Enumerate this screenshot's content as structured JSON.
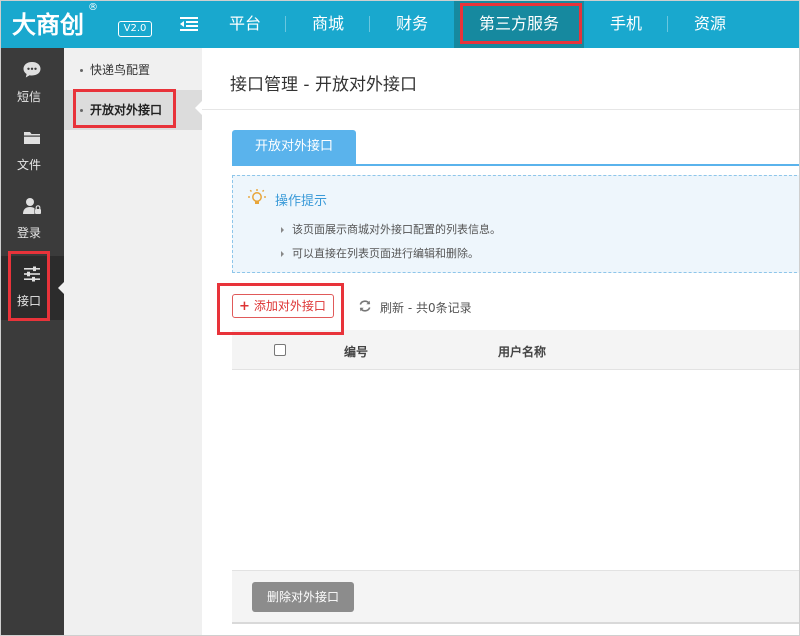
{
  "header": {
    "logo_text": "大商创",
    "logo_reg": "®",
    "version": "V2.0",
    "nav": [
      {
        "label": "平台"
      },
      {
        "label": "商城"
      },
      {
        "label": "财务"
      },
      {
        "label": "第三方服务"
      },
      {
        "label": "手机"
      },
      {
        "label": "资源"
      }
    ],
    "active_nav": "第三方服务"
  },
  "iconbar": {
    "items": [
      {
        "label": "短信",
        "icon": "sms-icon"
      },
      {
        "label": "文件",
        "icon": "folder-icon"
      },
      {
        "label": "登录",
        "icon": "user-lock-icon"
      },
      {
        "label": "接口",
        "icon": "sliders-icon"
      }
    ],
    "active": "接口"
  },
  "submenu": {
    "items": [
      {
        "label": "快递鸟配置"
      },
      {
        "label": "开放对外接口"
      }
    ],
    "active": "开放对外接口"
  },
  "main": {
    "title": "接口管理 - 开放对外接口",
    "tab": "开放对外接口",
    "tips": {
      "title": "操作提示",
      "icon": "lightbulb-icon",
      "lines": [
        "该页面展示商城对外接口配置的列表信息。",
        "可以直接在列表页面进行编辑和删除。"
      ]
    },
    "toolbar": {
      "add_label": "添加对外接口",
      "refresh_label": "刷新 - 共0条记录"
    },
    "table": {
      "columns": [
        "编号",
        "用户名称"
      ]
    },
    "footer": {
      "delete_label": "删除对外接口"
    }
  },
  "colors": {
    "topbar": "#19a8ce",
    "active_nav": "#16899f",
    "sidebar": "#3b3b3b",
    "highlight": "#e8333a",
    "tab": "#5ab3ec"
  }
}
